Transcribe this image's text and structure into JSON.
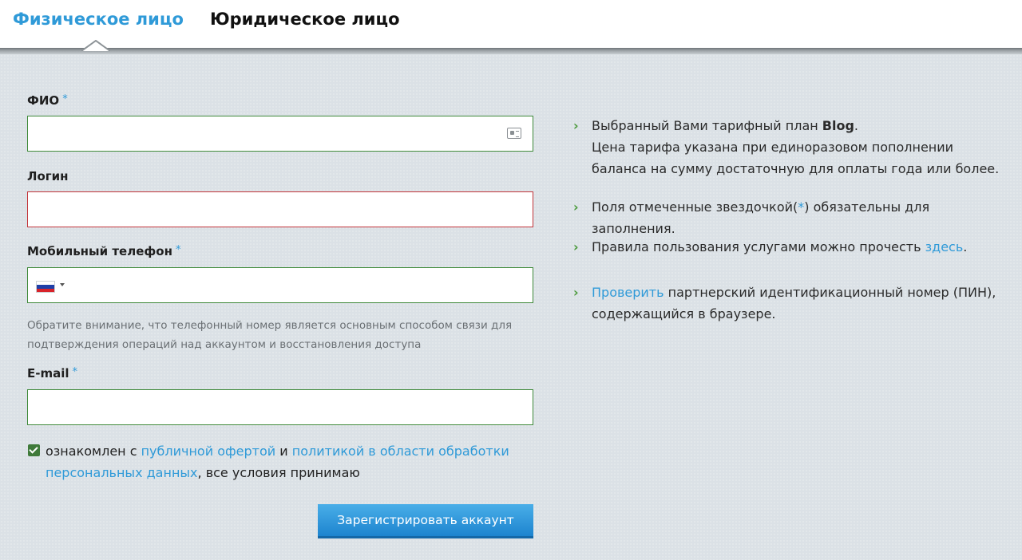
{
  "tabs": {
    "individual": "Физическое лицо",
    "legal": "Юридическое лицо"
  },
  "form": {
    "fio_label": "ФИО",
    "login_label": "Логин",
    "phone_label": "Мобильный телефон",
    "email_label": "E-mail",
    "required_mark": "*",
    "phone_note": "Обратите внимание, что телефонный номер является основным способом связи для подтверждения операций над аккаунтом и восстановления доступа",
    "agree_prefix": "ознакомлен с ",
    "agree_link1": "публичной офертой",
    "agree_mid": " и ",
    "agree_link2": "политикой в области обработки персональных данных",
    "agree_suffix": ", все условия принимаю",
    "submit_label": "Зарегистрировать аккаунт"
  },
  "info": {
    "plan_prefix": "Выбранный Вами тарифный план ",
    "plan_name": "Blog",
    "plan_suffix": ".",
    "plan_price_note": "Цена тарифа указана при единоразовом пополнении баланса на сумму достаточную для оплаты года или более.",
    "required_prefix": "Поля отмеченные звездочкой(",
    "required_star": "*",
    "required_suffix": ") обязательны для заполнения.",
    "rules_prefix": "Правила пользования услугами можно прочесть ",
    "rules_link": "здесь",
    "rules_suffix": ".",
    "check_link": "Проверить",
    "check_text": " партнерский идентификационный номер (ПИН), содержащийся в браузере."
  },
  "colors": {
    "accent": "#2f9ad8",
    "valid_border": "#3f8a3a",
    "error_border": "#c2353b"
  },
  "icons": [
    "contact-card-icon",
    "russia-flag-icon",
    "chevron-right-icon",
    "checkbox-checked-icon"
  ]
}
